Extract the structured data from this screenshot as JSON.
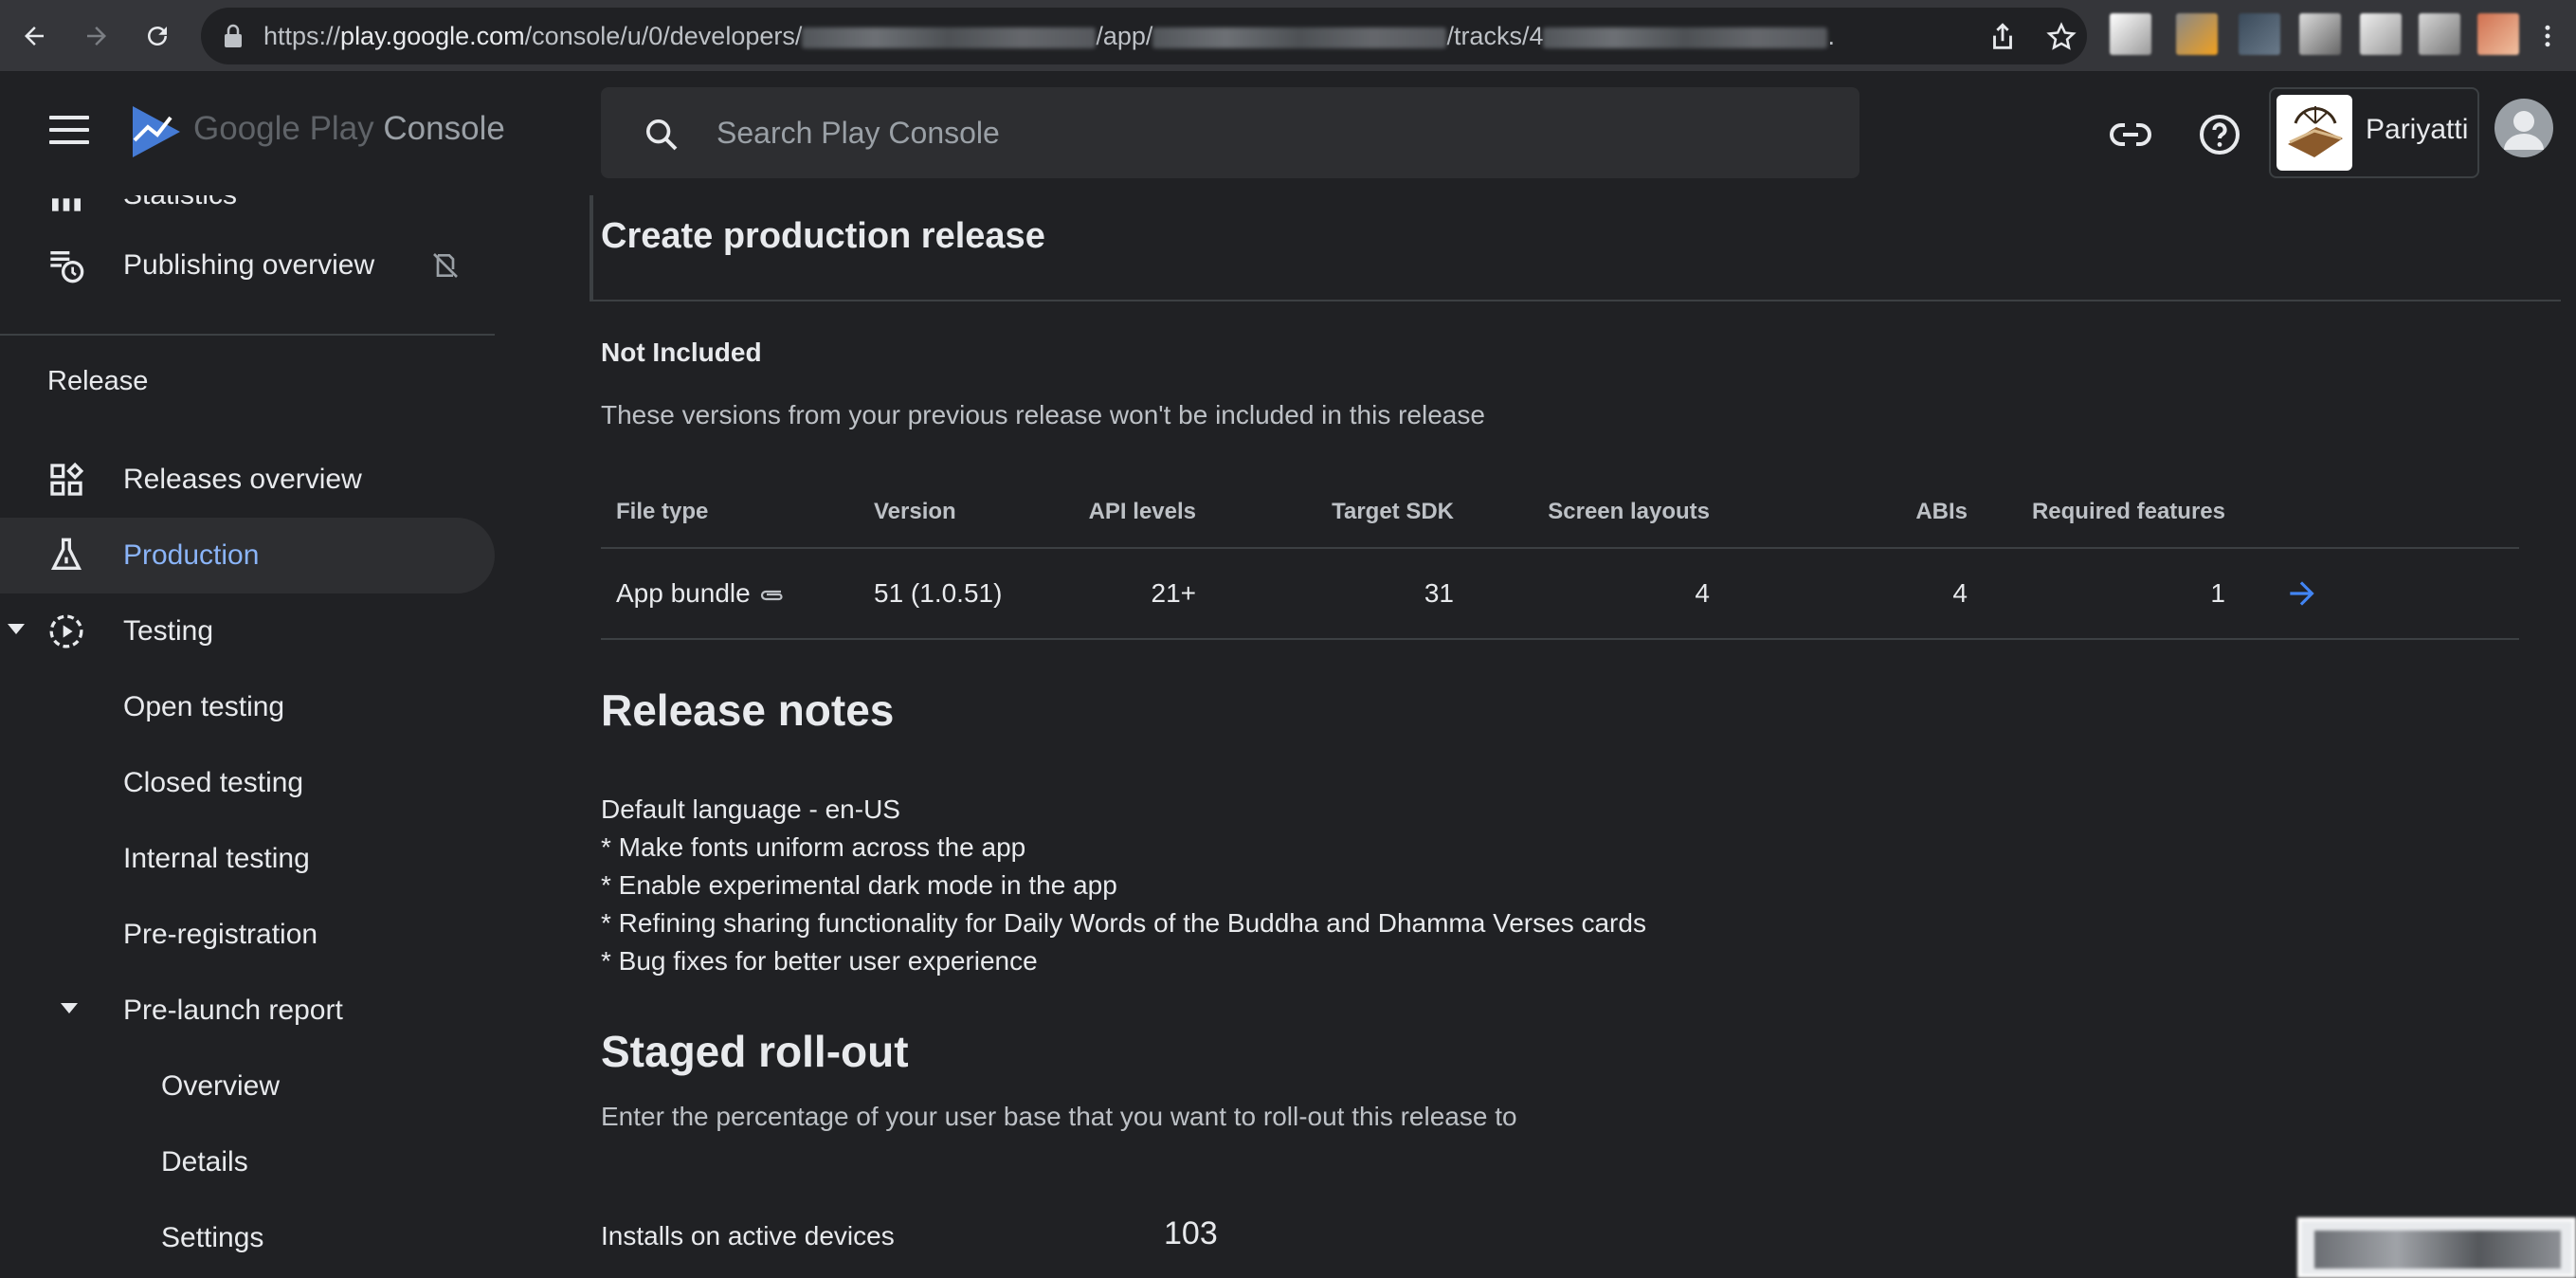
{
  "browser": {
    "url_prefix": "https://",
    "url_host": "play.google.com",
    "url_path_1": "/console/u/0/developers/",
    "url_path_2": "/app/",
    "url_path_3": "/tracks/4",
    "url_suffix": "."
  },
  "header": {
    "logo_text_google": "Google Play",
    "logo_text_console": " Console",
    "search_placeholder": "Search Play Console",
    "account_name": "Pariyatti"
  },
  "sidebar": {
    "partial_item": "Statistics",
    "publishing_overview": "Publishing overview",
    "section_release": "Release",
    "items": [
      {
        "label": "Releases overview"
      },
      {
        "label": "Production"
      },
      {
        "label": "Testing"
      },
      {
        "label": "Open testing"
      },
      {
        "label": "Closed testing"
      },
      {
        "label": "Internal testing"
      },
      {
        "label": "Pre-registration"
      },
      {
        "label": "Pre-launch report"
      },
      {
        "label": "Overview"
      },
      {
        "label": "Details"
      },
      {
        "label": "Settings"
      }
    ]
  },
  "main": {
    "title": "Create production release",
    "not_included_heading": "Not Included",
    "not_included_desc": "These versions from your previous release won't be included in this release",
    "table": {
      "headers": [
        "File type",
        "Version",
        "API levels",
        "Target SDK",
        "Screen layouts",
        "ABIs",
        "Required features"
      ],
      "row": {
        "file_type": "App bundle",
        "version": "51 (1.0.51)",
        "api_levels": "21+",
        "target_sdk": "31",
        "screen_layouts": "4",
        "abis": "4",
        "required_features": "1"
      }
    },
    "release_notes_heading": "Release notes",
    "release_notes_lines": [
      "Default language - en-US",
      "* Make fonts uniform across the app",
      "* Enable experimental dark mode in the app",
      "* Refining sharing functionality for Daily Words of the Buddha and Dhamma Verses cards",
      "* Bug fixes for better user experience"
    ],
    "staged_rollout_heading": "Staged roll-out",
    "staged_rollout_desc": "Enter the percentage of your user base that you want to roll-out this release to",
    "installs_label": "Installs on active devices",
    "installs_value": "103"
  },
  "colors": {
    "background": "#202124",
    "accent_blue": "#8ab4f8",
    "arrow_blue": "#4285f4",
    "divider": "#3c4043"
  }
}
